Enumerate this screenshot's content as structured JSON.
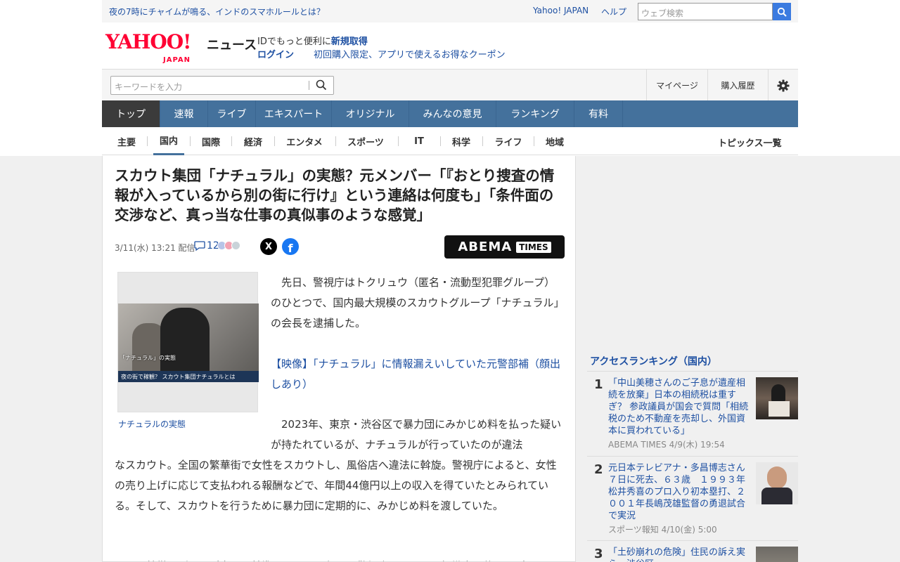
{
  "topbar": {
    "promo": "夜の7時にチャイムが鳴る、インドのスマホルールとは？",
    "yahoo_japan": "Yahoo! JAPAN",
    "help": "ヘルプ",
    "web_search_placeholder": "ウェブ検索"
  },
  "header": {
    "logo_text": "YAHOO!",
    "logo_sub": "JAPAN",
    "service": "ニュース",
    "id_text": "IDでもっと便利に",
    "signup": "新規取得",
    "login": "ログイン",
    "coupon": "初回購入限定、アプリで使えるお得なクーポン"
  },
  "search": {
    "placeholder": "キーワードを入力",
    "mypage": "マイページ",
    "history": "購入履歴"
  },
  "mainnav": [
    "トップ",
    "速報",
    "ライブ",
    "エキスパート",
    "オリジナル",
    "みんなの意見",
    "ランキング",
    "有料"
  ],
  "subnav": [
    "主要",
    "国内",
    "国際",
    "経済",
    "エンタメ",
    "スポーツ",
    "IT",
    "科学",
    "ライフ",
    "地域"
  ],
  "topics_all": "トピックス一覧",
  "article": {
    "headline": "スカウト集団「ナチュラル」の実態？元メンバー「『おとり捜査の情報が入っているから別の街に行け』という連絡は何度も」「条件面の交渉など、真っ当な仕事の真似事のような感覚」",
    "date": "3/11(水) 13:21",
    "delivered": "配信",
    "comment_count": "12",
    "x_label": "X",
    "fb_label": "f",
    "source_logo": "ABEMA",
    "source_logo_sub": "TIMES",
    "photo_caption_overlay": "「ナチュラル」の実態",
    "photo_caption_bar": "夜の街で稼観？ スカウト集団ナチュラルとは",
    "photo_caption": "ナチュラルの実態",
    "para1": "　先日、警視庁はトクリュウ（匿名・流動型犯罪グループ）のひとつで、国内最大規模のスカウトグループ「ナチュラル」の会長を逮捕した。",
    "para2": "【映像】「ナチュラル」に情報漏えいしていた元警部補（顔出しあり）",
    "para3_indent": "　2023年、東京・渋谷区で暴力団にみかじめ料を払った疑いが持たれているが、ナチュラルが行っていたのが違法",
    "para3_rest": "なスカウト。全国の繁華街で女性をスカウトし、風俗店へ違法に斡旋。警視庁によると、女性の売り上げに応じて支払われる報酬などで、年間44億円以上の収入を得ていたとみられている。そして、スカウトを行うために暴力団に定期的に、みかじめ料を渡していた。",
    "para4": "　その特徴はグループ内での基準は“SNS”で行い、警視庁によると、組織内で使うアプリは"
  },
  "ranking": {
    "title": "アクセスランキング（国内）",
    "items": [
      {
        "rank": "1",
        "title": "「中山美穂さんのご子息が遺産相続を放棄」日本の相続税は重すぎ？ 参政議員が国会で質問「相続税のため不動産を売却し、外国資本に買われている」",
        "meta": "ABEMA TIMES 4/9(木) 19:54"
      },
      {
        "rank": "2",
        "title": "元日本テレビアナ・多昌博志さん７日に死去、６３歳　１９９３年松井秀喜のプロ入り初本塁打、２００１年長嶋茂雄監督の勇退試合で実況",
        "meta": "スポーツ報知 4/10(金) 5:00"
      },
      {
        "rank": "3",
        "title": "「土砂崩れの危険」住民の訴え実ら…渋谷区…",
        "meta": ""
      }
    ]
  },
  "colors": {
    "nav_bg": "#44719c",
    "nav_active": "#3b3b3b",
    "link": "#1e50a2",
    "yahoo_red": "#ff0033"
  }
}
